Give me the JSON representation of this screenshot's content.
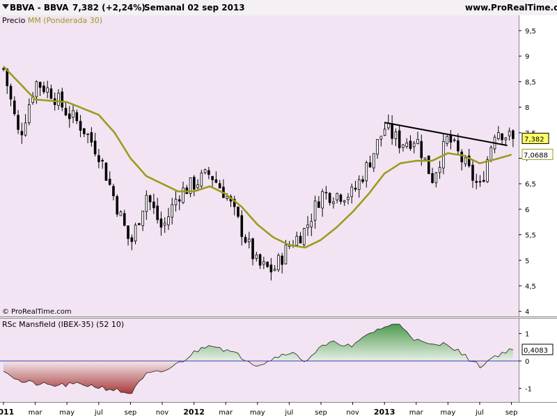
{
  "header": {
    "symbol": "BBVA - BBVA",
    "last_change": "7,382 (+2,24%)",
    "period_date": "Semanal  02 sep 2013",
    "website": "www.ProRealTime.com"
  },
  "panel1": {
    "legend_price": "Precio",
    "legend_ma": "MM (Ponderada 30)",
    "copyright": "© ProRealTime.com"
  },
  "panel2": {
    "legend": "RSc Mansfield (IBEX-35) (52 10)"
  },
  "colors": {
    "panel_bg": "#f2e4f2",
    "ma_line": "#9b9b1e",
    "area_positive": "#4f9a4f",
    "area_negative": "#a83a3a",
    "zero_line": "#3a3ab8",
    "trend_line": "#000000",
    "price_badge": "#ffff66",
    "ma_badge": "#ffffff"
  },
  "chart_data": [
    {
      "type": "candlestick",
      "title": "BBVA - BBVA",
      "series": [
        {
          "name": "Precio"
        },
        {
          "name": "MM (Ponderada 30)"
        }
      ],
      "x_tick_labels": [
        "2011",
        "mar",
        "may",
        "jul",
        "sep",
        "nov",
        "2012",
        "mar",
        "may",
        "jul",
        "sep",
        "nov",
        "2013",
        "mar",
        "may",
        "jul",
        "sep"
      ],
      "x_tick_years": [
        "2011",
        "2012",
        "2013"
      ],
      "y_ticks": [
        "4",
        "4,5",
        "5",
        "5,5",
        "6",
        "6,5",
        "7",
        "7,5",
        "8",
        "8,5",
        "9",
        "9,5"
      ],
      "ylim": [
        3.9,
        9.8
      ],
      "close_anchors": [
        {
          "x": "2011-01",
          "y": 8.75
        },
        {
          "x": "2011-02",
          "y": 7.4
        },
        {
          "x": "2011-03",
          "y": 8.5
        },
        {
          "x": "2011-04",
          "y": 8.3
        },
        {
          "x": "2011-05",
          "y": 7.9
        },
        {
          "x": "2011-06",
          "y": 7.6
        },
        {
          "x": "2011-07",
          "y": 7.1
        },
        {
          "x": "2011-08",
          "y": 6.2
        },
        {
          "x": "2011-09",
          "y": 5.3
        },
        {
          "x": "2011-10",
          "y": 6.3
        },
        {
          "x": "2011-11",
          "y": 5.6
        },
        {
          "x": "2011-12",
          "y": 6.3
        },
        {
          "x": "2012-01",
          "y": 6.5
        },
        {
          "x": "2012-02",
          "y": 6.7
        },
        {
          "x": "2012-03",
          "y": 6.3
        },
        {
          "x": "2012-04",
          "y": 5.6
        },
        {
          "x": "2012-05",
          "y": 4.9
        },
        {
          "x": "2012-06",
          "y": 4.8
        },
        {
          "x": "2012-07",
          "y": 5.3
        },
        {
          "x": "2012-08",
          "y": 5.6
        },
        {
          "x": "2012-09",
          "y": 6.3
        },
        {
          "x": "2012-10",
          "y": 6.3
        },
        {
          "x": "2012-11",
          "y": 6.3
        },
        {
          "x": "2012-12",
          "y": 6.9
        },
        {
          "x": "2013-01",
          "y": 7.6
        },
        {
          "x": "2013-02",
          "y": 7.3
        },
        {
          "x": "2013-03",
          "y": 7.4
        },
        {
          "x": "2013-04",
          "y": 6.6
        },
        {
          "x": "2013-05",
          "y": 7.4
        },
        {
          "x": "2013-06",
          "y": 6.9
        },
        {
          "x": "2013-07",
          "y": 6.4
        },
        {
          "x": "2013-08",
          "y": 7.6
        },
        {
          "x": "2013-09",
          "y": 7.382
        }
      ],
      "ma_anchors": [
        {
          "x": "2011-01",
          "y": 8.8
        },
        {
          "x": "2011-03",
          "y": 8.15
        },
        {
          "x": "2011-05",
          "y": 8.1
        },
        {
          "x": "2011-07",
          "y": 7.85
        },
        {
          "x": "2011-08",
          "y": 7.5
        },
        {
          "x": "2011-09",
          "y": 7.0
        },
        {
          "x": "2011-10",
          "y": 6.65
        },
        {
          "x": "2011-11",
          "y": 6.5
        },
        {
          "x": "2011-12",
          "y": 6.35
        },
        {
          "x": "2012-01",
          "y": 6.35
        },
        {
          "x": "2012-02",
          "y": 6.45
        },
        {
          "x": "2012-03",
          "y": 6.3
        },
        {
          "x": "2012-04",
          "y": 6.05
        },
        {
          "x": "2012-05",
          "y": 5.7
        },
        {
          "x": "2012-06",
          "y": 5.45
        },
        {
          "x": "2012-07",
          "y": 5.3
        },
        {
          "x": "2012-08",
          "y": 5.25
        },
        {
          "x": "2012-09",
          "y": 5.4
        },
        {
          "x": "2012-10",
          "y": 5.65
        },
        {
          "x": "2012-11",
          "y": 5.95
        },
        {
          "x": "2012-12",
          "y": 6.3
        },
        {
          "x": "2013-01",
          "y": 6.7
        },
        {
          "x": "2013-02",
          "y": 6.9
        },
        {
          "x": "2013-03",
          "y": 6.95
        },
        {
          "x": "2013-04",
          "y": 6.95
        },
        {
          "x": "2013-05",
          "y": 7.1
        },
        {
          "x": "2013-06",
          "y": 7.05
        },
        {
          "x": "2013-07",
          "y": 6.9
        },
        {
          "x": "2013-08",
          "y": 6.98
        },
        {
          "x": "2013-09",
          "y": 7.0688
        }
      ],
      "trend_line": [
        {
          "x": "2013-01",
          "y": 7.7
        },
        {
          "x": "2013-09",
          "y": 7.25
        }
      ],
      "last_price_label": "7,382",
      "ma_value_label": "7,0688"
    },
    {
      "type": "area",
      "title": "RSc Mansfield (IBEX-35) (52 10)",
      "y_ticks": [
        "-1",
        "0",
        "1"
      ],
      "ylim": [
        -1.5,
        1.55
      ],
      "values": [
        {
          "x": "2011-01",
          "y": -0.3
        },
        {
          "x": "2011-02",
          "y": -0.75
        },
        {
          "x": "2011-04",
          "y": -0.9
        },
        {
          "x": "2011-06",
          "y": -0.85
        },
        {
          "x": "2011-08",
          "y": -1.05
        },
        {
          "x": "2011-09",
          "y": -1.2
        },
        {
          "x": "2011-10",
          "y": -0.5
        },
        {
          "x": "2011-11",
          "y": -0.4
        },
        {
          "x": "2011-12",
          "y": -0.1
        },
        {
          "x": "2012-01",
          "y": 0.3
        },
        {
          "x": "2012-02",
          "y": 0.65
        },
        {
          "x": "2012-03",
          "y": 0.4
        },
        {
          "x": "2012-04",
          "y": 0.15
        },
        {
          "x": "2012-05",
          "y": -0.15
        },
        {
          "x": "2012-06",
          "y": 0.1
        },
        {
          "x": "2012-07",
          "y": 0.35
        },
        {
          "x": "2012-08",
          "y": 0.0
        },
        {
          "x": "2012-09",
          "y": 0.5
        },
        {
          "x": "2012-10",
          "y": 0.7
        },
        {
          "x": "2012-11",
          "y": 0.5
        },
        {
          "x": "2012-12",
          "y": 1.0
        },
        {
          "x": "2013-01",
          "y": 1.25
        },
        {
          "x": "2013-02",
          "y": 1.35
        },
        {
          "x": "2013-03",
          "y": 0.75
        },
        {
          "x": "2013-04",
          "y": 0.55
        },
        {
          "x": "2013-05",
          "y": 0.65
        },
        {
          "x": "2013-06",
          "y": 0.2
        },
        {
          "x": "2013-07",
          "y": -0.2
        },
        {
          "x": "2013-08",
          "y": 0.2
        },
        {
          "x": "2013-09",
          "y": 0.4083
        }
      ],
      "last_value_label": "0,4083"
    }
  ]
}
